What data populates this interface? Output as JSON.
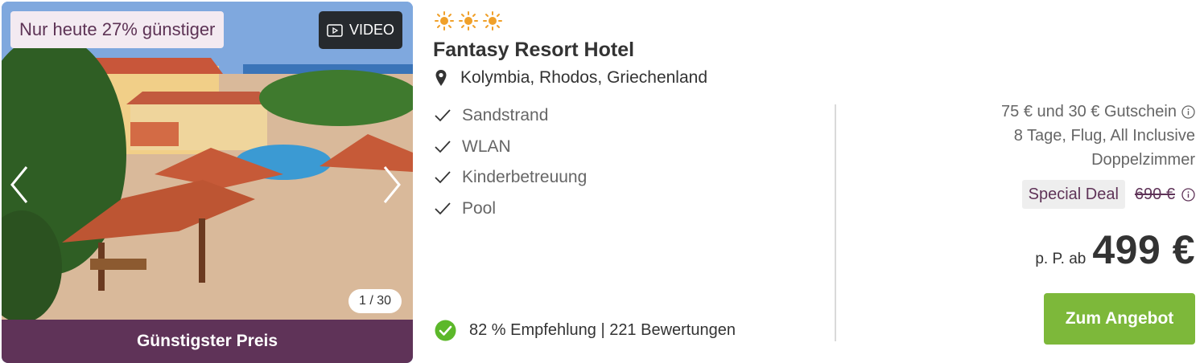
{
  "gallery": {
    "discount_badge": "Nur heute 27% günstiger",
    "video_label": "VIDEO",
    "counter": "1 / 30",
    "cheapest_label": "Günstigster Preis",
    "prev_icon": "chevron-left-icon",
    "next_icon": "chevron-right-icon"
  },
  "hotel": {
    "star_count": 3,
    "star_icon": "sun-icon",
    "star_color": "#f0a02a",
    "name": "Fantasy Resort Hotel",
    "location": "Kolymbia, Rhodos, Griechenland",
    "features": [
      "Sandstrand",
      "WLAN",
      "Kinderbetreuung",
      "Pool"
    ],
    "rating_text": "82 % Empfehlung | 221 Bewertungen",
    "rating_icon": "check-circle-icon",
    "rating_color": "#5cb82a"
  },
  "offer": {
    "voucher": "75 € und 30 € Gutschein",
    "details": "8 Tage, Flug, All Inclusive",
    "room": "Doppelzimmer",
    "special_deal": "Special Deal",
    "old_price": "690 €",
    "price_prefix": "p. P. ab",
    "price": "499 €",
    "button_label": "Zum Angebot",
    "button_color": "#7db83a",
    "brand_color": "#5f3358"
  }
}
